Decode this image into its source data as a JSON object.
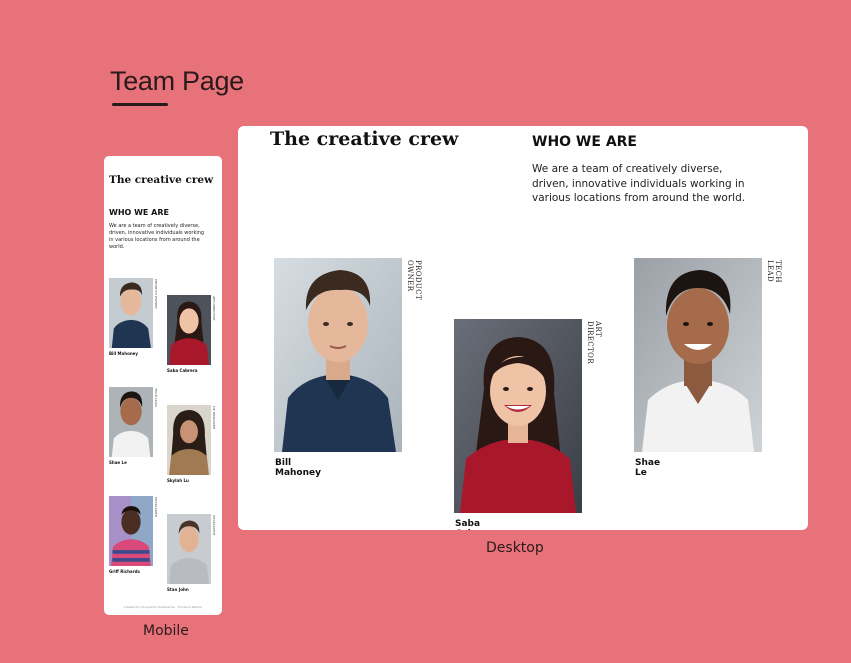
{
  "page": {
    "title": "Team Page",
    "background": "#e8727a"
  },
  "frames": {
    "mobile_label": "Mobile",
    "desktop_label": "Desktop"
  },
  "site": {
    "heading": "The creative crew",
    "section_title": "WHO WE ARE",
    "description": "We are a team of creatively diverse, driven, innovative individuals working in various locations from around the world.",
    "footer": "Created by Shreyansh Deshpande · Frontend Mentor"
  },
  "team": [
    {
      "name": "Bill Mahoney",
      "role": "PRODUCT OWNER",
      "photo": "bill-mahoney-photo"
    },
    {
      "name": "Saba Cabrera",
      "role": "ART DIRECTOR",
      "photo": "saba-cabrera-photo"
    },
    {
      "name": "Shae Le",
      "role": "TECH LEAD",
      "photo": "shae-le-photo"
    },
    {
      "name": "Skylah Lu",
      "role": "UX DESIGNER",
      "photo": "skylah-lu-photo"
    },
    {
      "name": "Griff Richards",
      "role": "DEVELOPER",
      "photo": "griff-richards-photo"
    },
    {
      "name": "Stan John",
      "role": "DEVELOPER",
      "photo": "stan-john-photo"
    }
  ]
}
